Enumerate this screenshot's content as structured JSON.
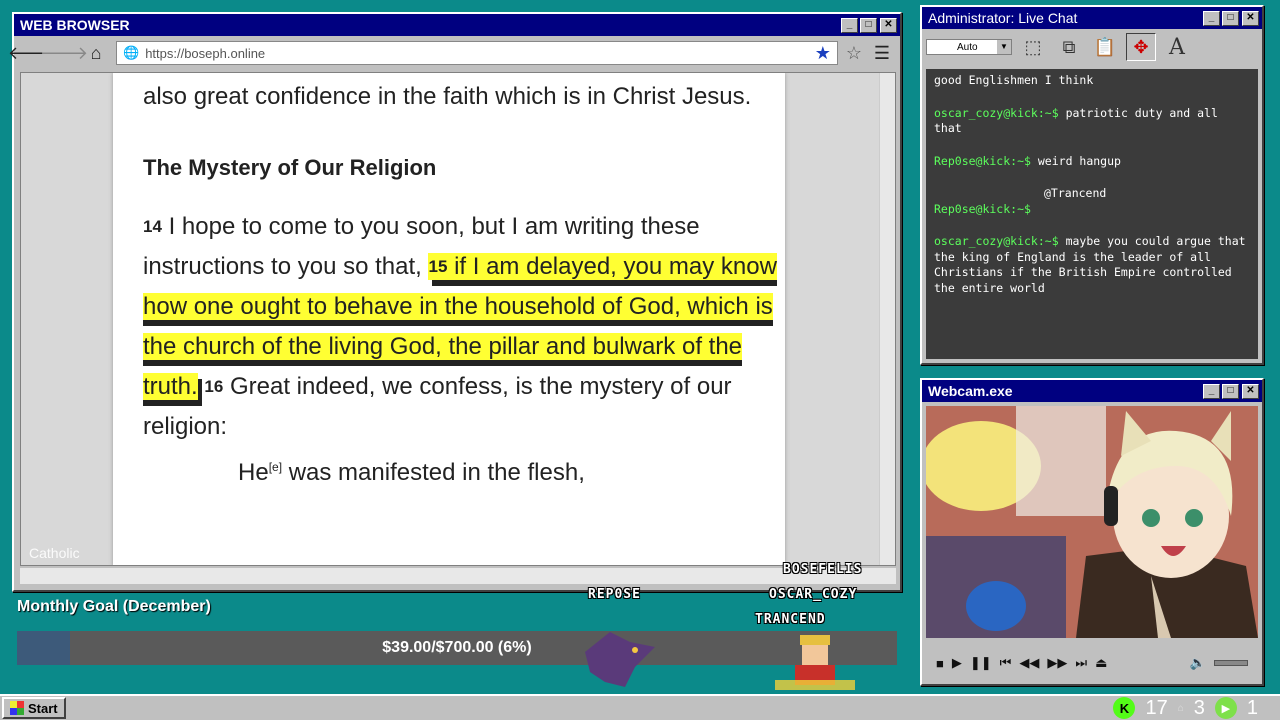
{
  "browser": {
    "title": "WEB BROWSER",
    "url": "https://boseph.online",
    "watermark": "Catholic"
  },
  "document": {
    "intro": "also great confidence in the faith which is in Christ Jesus.",
    "heading": "The Mystery of Our Religion",
    "v14_num": "14",
    "v14_text": "I hope to come to you soon, but I am writing these instructions to you so that,",
    "v15_num": "15",
    "v15_text": "if I am delayed, you may know how one ought to behave in the household of God, which is the church of the living God, the pillar and bulwark of the truth.",
    "v16_num": "16",
    "v16_text": "Great indeed, we confess, is the mystery of our religion:",
    "poem_line": "He",
    "footnote": "[e]",
    "poem_rest": "was manifested in the flesh,"
  },
  "chat": {
    "title": "Administrator: Live Chat",
    "dropdown": "Auto",
    "messages": [
      {
        "user": "",
        "text": "good Englishmen I think"
      },
      {
        "user": "oscar_cozy@kick:~$",
        "text": "patriotic duty and all that"
      },
      {
        "user": "Rep0se@kick:~$",
        "text": "weird hangup"
      },
      {
        "user": "Rep0se@kick:~$",
        "text": "@Trancend",
        "mention": true
      },
      {
        "user": "oscar_cozy@kick:~$",
        "text": "maybe you could argue that the king of England is the leader of all Christians if the British Empire controlled the entire world"
      }
    ]
  },
  "webcam": {
    "title": "Webcam.exe"
  },
  "goal": {
    "title": "Monthly Goal (December)",
    "text": "$39.00/$700.00 (6%)",
    "progress": 0.06
  },
  "overlay_names": [
    "REP0SE",
    "BOSEFELIS",
    "OSCAR_COZY",
    "TRANCEND"
  ],
  "taskbar": {
    "start": "Start",
    "count_a": "17",
    "count_b": "3",
    "count_c": "1"
  }
}
